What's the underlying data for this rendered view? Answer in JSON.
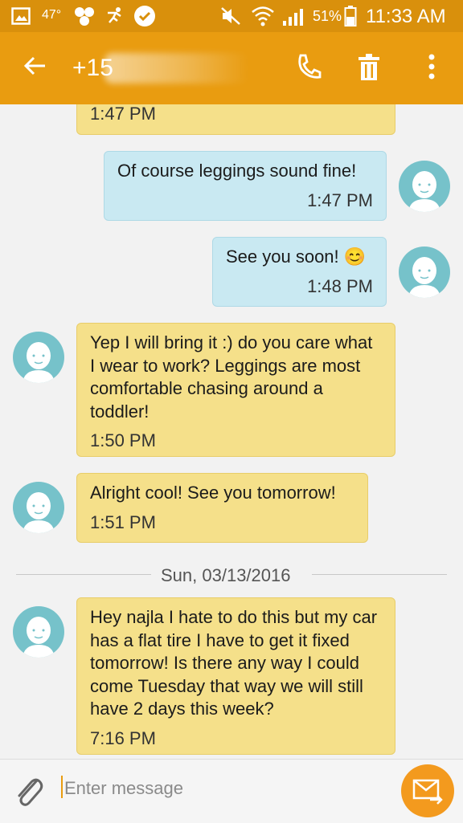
{
  "status_bar": {
    "temperature": "47°",
    "battery": "51%",
    "time": "11:33 AM",
    "icons": [
      "gallery-icon",
      "weather-icon",
      "hexagons-icon",
      "running-icon",
      "check-badge-icon",
      "mute-icon",
      "wifi-icon",
      "signal-icon",
      "battery-icon"
    ]
  },
  "app_bar": {
    "contact": "+15",
    "icons": [
      "back-arrow-icon",
      "phone-icon",
      "trash-icon",
      "more-vert-icon"
    ]
  },
  "messages": [
    {
      "dir": "received",
      "text": "",
      "time": "1:47 PM"
    },
    {
      "dir": "sent",
      "text": "Of course leggings sound fine!",
      "time": "1:47 PM"
    },
    {
      "dir": "sent",
      "text": "See you soon! 😊",
      "time": "1:48 PM"
    },
    {
      "dir": "received",
      "text": "Yep I will bring it :) do you care what I wear to work? Leggings are most comfortable chasing around a toddler!",
      "time": "1:50 PM"
    },
    {
      "dir": "received",
      "text": "Alright cool! See you tomorrow!",
      "time": "1:51 PM"
    },
    {
      "dir": "received",
      "text": "Hey najla I hate to do this but my car has a flat tire I have to get it fixed tomorrow! Is there any way I could come Tuesday that way we will still have 2 days this week?",
      "time": "7:16 PM"
    }
  ],
  "date_divider": "Sun, 03/13/2016",
  "composer": {
    "placeholder": "Enter message",
    "icons": [
      "paperclip-icon",
      "send-icon"
    ]
  },
  "colors": {
    "status_bar": "#d9900c",
    "app_bar": "#e99c10",
    "received_bubble": "#f5e08a",
    "sent_bubble": "#c9e9f2",
    "avatar": "#76c2ca",
    "send_button": "#f39a1e"
  }
}
